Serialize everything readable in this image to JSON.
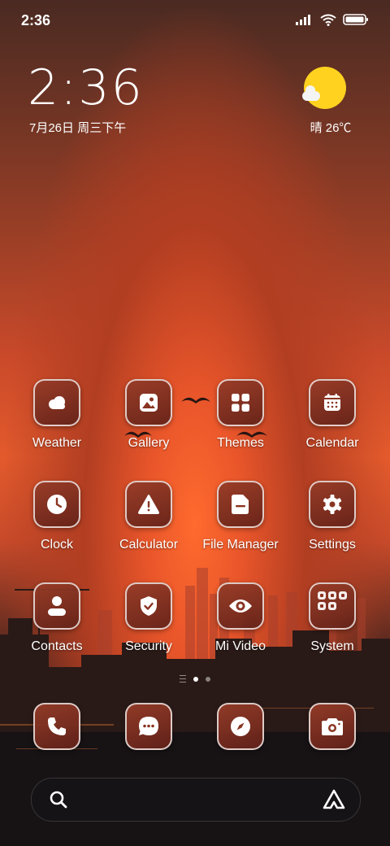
{
  "status_bar": {
    "time": "2:36"
  },
  "widget": {
    "clock": "2:36",
    "date": "7月26日 周三下午",
    "weather": "晴 26℃"
  },
  "apps": [
    {
      "label": "Weather",
      "icon": "cloud-icon"
    },
    {
      "label": "Gallery",
      "icon": "image-icon"
    },
    {
      "label": "Themes",
      "icon": "grid-icon"
    },
    {
      "label": "Calendar",
      "icon": "calendar-icon"
    },
    {
      "label": "Clock",
      "icon": "clock-icon"
    },
    {
      "label": "Calculator",
      "icon": "warning-icon"
    },
    {
      "label": "File Manager",
      "icon": "folder-icon"
    },
    {
      "label": "Settings",
      "icon": "gear-icon"
    },
    {
      "label": "Contacts",
      "icon": "person-icon"
    },
    {
      "label": "Security",
      "icon": "shield-icon"
    },
    {
      "label": "Mi Video",
      "icon": "eye-icon"
    },
    {
      "label": "System",
      "icon": "folder-grid-icon"
    }
  ],
  "dock": [
    {
      "icon": "phone-icon"
    },
    {
      "icon": "message-icon"
    },
    {
      "icon": "compass-icon"
    },
    {
      "icon": "camera-icon"
    }
  ],
  "colors": {
    "sun": "#ffd21f",
    "icon_bg": "#8a3422"
  }
}
